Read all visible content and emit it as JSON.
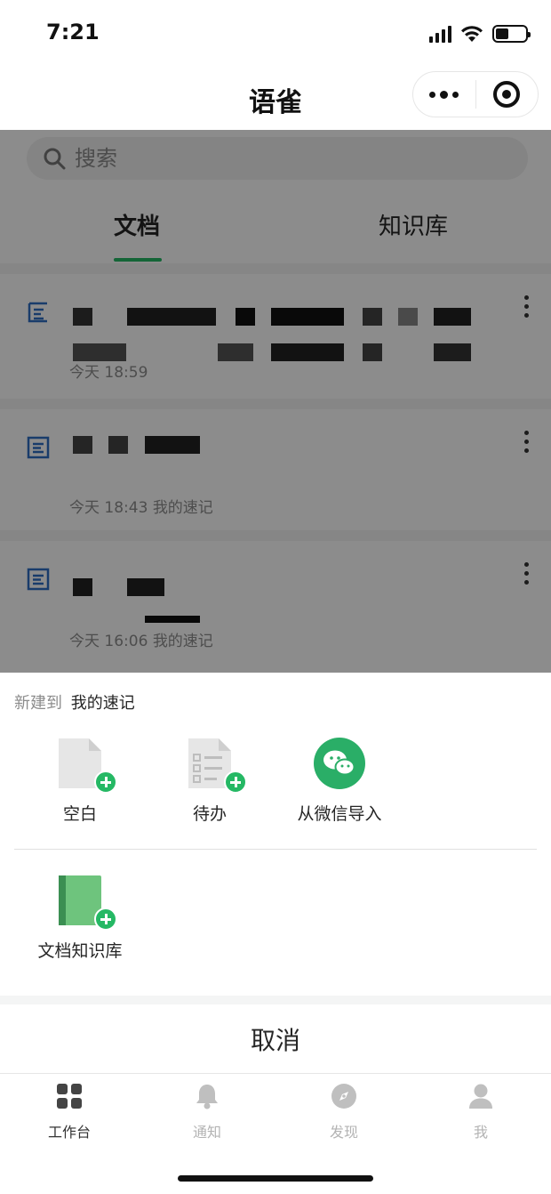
{
  "status_bar": {
    "time": "7:21"
  },
  "nav": {
    "title": "语雀"
  },
  "search": {
    "placeholder": "搜索"
  },
  "tabs": [
    {
      "label": "文档",
      "active": true
    },
    {
      "label": "知识库",
      "active": false
    }
  ],
  "documents": [
    {
      "time": "今天 18:59",
      "location": ""
    },
    {
      "time": "今天 18:43",
      "location": "我的速记"
    },
    {
      "time": "今天 16:06",
      "location": "我的速记"
    }
  ],
  "sheet": {
    "header_label": "新建到",
    "header_target": "我的速记",
    "items": [
      {
        "label": "空白",
        "icon": "blank-doc-icon"
      },
      {
        "label": "待办",
        "icon": "todo-doc-icon"
      },
      {
        "label": "从微信导入",
        "icon": "wechat-icon"
      },
      {
        "label": "文档知识库",
        "icon": "book-icon"
      }
    ],
    "cancel": "取消"
  },
  "tab_bar": [
    {
      "label": "工作台",
      "icon": "grid-icon",
      "active": true
    },
    {
      "label": "通知",
      "icon": "bell-icon",
      "active": false
    },
    {
      "label": "发现",
      "icon": "compass-icon",
      "active": false
    },
    {
      "label": "我",
      "icon": "user-icon",
      "active": false
    }
  ],
  "colors": {
    "accent": "#25b864",
    "doc_icon": "#2f6ec4",
    "wechat": "#2aae67",
    "book": "#5bbf6f"
  }
}
